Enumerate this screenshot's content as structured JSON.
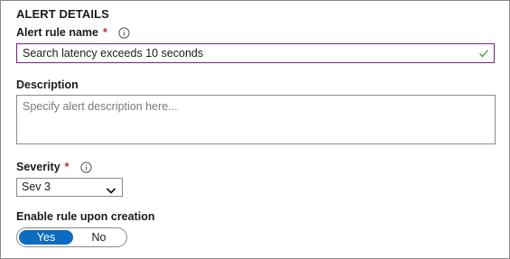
{
  "section": {
    "title": "ALERT DETAILS"
  },
  "alert_rule_name": {
    "label": "Alert rule name",
    "required_mark": "*",
    "info_icon": "info-icon",
    "value": "Search latency exceeds 10 seconds",
    "valid_icon": "check-icon",
    "valid_color": "#3c9a3c"
  },
  "description": {
    "label": "Description",
    "value": "",
    "placeholder": "Specify alert description here..."
  },
  "severity": {
    "label": "Severity",
    "required_mark": "*",
    "info_icon": "info-icon",
    "selected": "Sev 3",
    "dropdown_icon": "chevron-down-icon"
  },
  "enable_rule": {
    "label": "Enable rule upon creation",
    "options": [
      "Yes",
      "No"
    ],
    "selected": "Yes",
    "accent_color": "#0b6cc0"
  },
  "colors": {
    "required": "#c4262e",
    "focus_border": "#7a1f8a",
    "placeholder": "#7a7a7a"
  }
}
